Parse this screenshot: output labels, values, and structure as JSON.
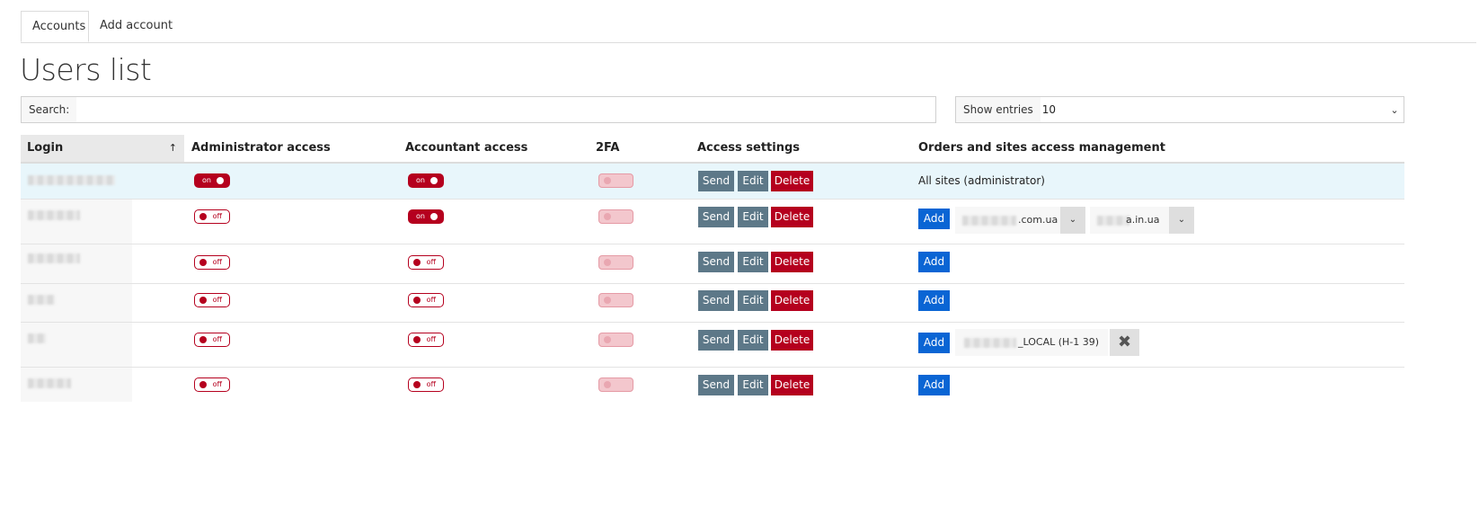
{
  "tabs": [
    {
      "label": "Accounts"
    },
    {
      "label": "Add account"
    }
  ],
  "page_title": "Users list",
  "search": {
    "label": "Search:",
    "value": ""
  },
  "entries": {
    "label": "Show entries",
    "value": "10"
  },
  "table": {
    "headers": {
      "login": "Login",
      "sort_arrow": "↑",
      "admin": "Administrator access",
      "accountant": "Accountant access",
      "twofa": "2FA",
      "access_settings": "Access settings",
      "orders": "Orders and sites access management"
    },
    "buttons": {
      "send": "Send",
      "edit": "Edit",
      "delete": "Delete",
      "add": "Add"
    },
    "toggle_labels": {
      "on": "on",
      "off": "off"
    },
    "rows": [
      {
        "admin": "on",
        "accountant": "on",
        "twofa": "disabled",
        "access_text": "All sites (administrator)"
      },
      {
        "admin": "off",
        "accountant": "on",
        "twofa": "disabled",
        "sites": [
          ".com.ua",
          "a.in.ua"
        ]
      },
      {
        "admin": "off",
        "accountant": "off",
        "twofa": "disabled"
      },
      {
        "admin": "off",
        "accountant": "off",
        "twofa": "disabled"
      },
      {
        "admin": "off",
        "accountant": "off",
        "twofa": "disabled",
        "order": "_LOCAL (H-1 39)"
      },
      {
        "admin": "off",
        "accountant": "off",
        "twofa": "disabled"
      }
    ]
  },
  "icons": {
    "chevron": "chevron-down-icon",
    "remove": "close-icon"
  },
  "colors": {
    "danger": "#b5001e",
    "primary": "#0a65d4",
    "secondary": "#5d7888",
    "highlight": "#e8f6fb"
  }
}
